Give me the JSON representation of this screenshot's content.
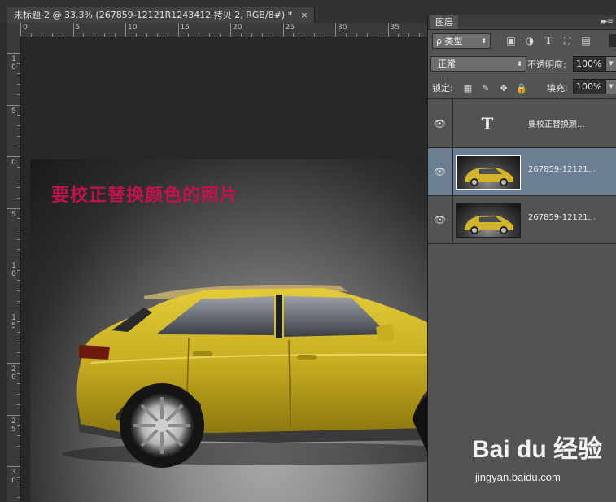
{
  "document_tab": {
    "title": "未标题-2 @ 33.3% (267859-12121R1243412 拷贝 2, RGB/8#) *",
    "close": "×"
  },
  "ruler_top": {
    "labels": [
      "0",
      "5",
      "10",
      "15",
      "20",
      "25",
      "30",
      "35"
    ]
  },
  "ruler_left": {
    "labels": [
      [
        "1",
        "0"
      ],
      [
        "5"
      ],
      [
        "0"
      ],
      [
        "5"
      ],
      [
        "1",
        "0"
      ],
      [
        "1",
        "5"
      ],
      [
        "2",
        "0"
      ],
      [
        "2",
        "5"
      ],
      [
        "3",
        "0"
      ]
    ]
  },
  "canvas": {
    "overlay_text": "要校正替换颜色的照片"
  },
  "layers_panel": {
    "tab_label": "图层",
    "menu_icon": "▸▸ ≡",
    "filter": {
      "label": "ρ 类型",
      "arrow": "⬍"
    },
    "filter_icons": [
      "image-filter-icon",
      "adjustment-filter-icon",
      "type-filter-icon",
      "shape-filter-icon",
      "smart-object-filter-icon"
    ],
    "blend_mode": {
      "value": "正常",
      "arrow": "⬍"
    },
    "opacity": {
      "label": "不透明度:",
      "value": "100%"
    },
    "lock": {
      "label": "锁定:"
    },
    "fill": {
      "label": "填充:",
      "value": "100%"
    },
    "layers": [
      {
        "name": "要校正替换颜...",
        "kind": "text",
        "thumb_glyph": "T",
        "selected": false
      },
      {
        "name": "267859-12121...",
        "kind": "image",
        "selected": true
      },
      {
        "name": "267859-12121...",
        "kind": "image",
        "selected": false
      }
    ]
  },
  "watermark": {
    "logo": "Bai du 经验",
    "url": "jingyan.baidu.com"
  }
}
